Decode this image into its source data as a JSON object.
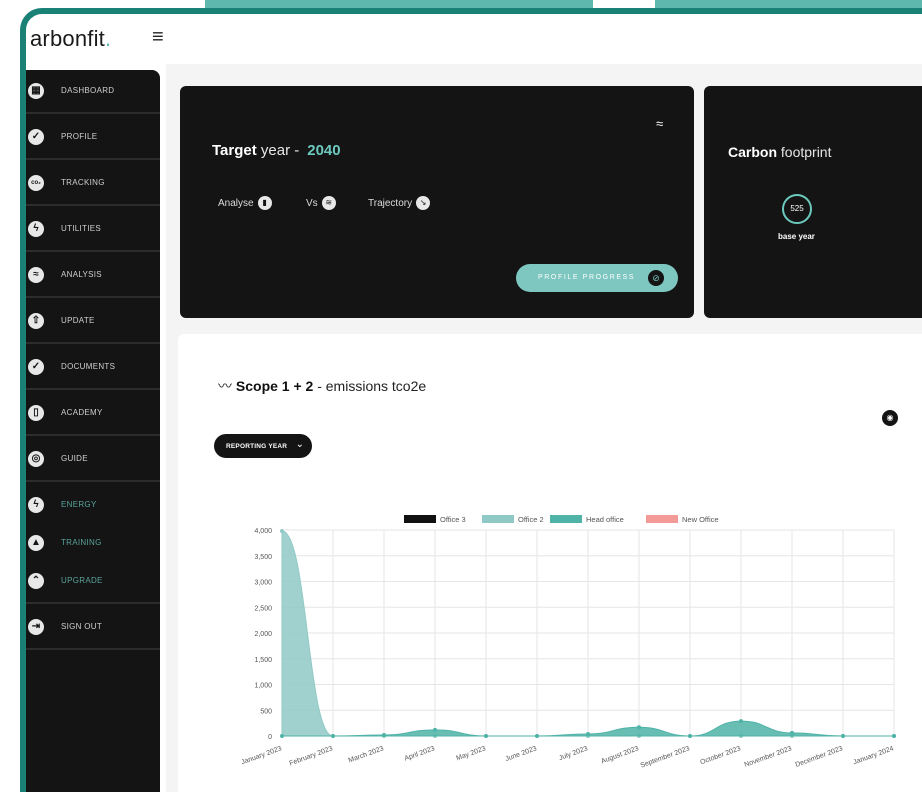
{
  "brand": {
    "name": "arbonfit",
    "dot": "."
  },
  "sidebar": {
    "items": [
      {
        "label": "DASHBOARD",
        "icon": "grid-icon"
      },
      {
        "label": "PROFILE",
        "icon": "shield-check-icon"
      },
      {
        "label": "TRACKING",
        "icon": "co2-icon"
      },
      {
        "label": "UTILITIES",
        "icon": "bolt-icon"
      },
      {
        "label": "ANALYSIS",
        "icon": "trend-icon"
      },
      {
        "label": "UPDATE",
        "icon": "upload-icon"
      },
      {
        "label": "DOCUMENTS",
        "icon": "badge-check-icon"
      },
      {
        "label": "ACADEMY",
        "icon": "book-icon"
      },
      {
        "label": "GUIDE",
        "icon": "compass-icon"
      },
      {
        "label": "ENERGY",
        "icon": "bolt-icon"
      },
      {
        "label": "TRAINING",
        "icon": "graduation-icon"
      },
      {
        "label": "UPGRADE",
        "icon": "arrow-up-icon"
      },
      {
        "label": "SIGN OUT",
        "icon": "sign-out-icon"
      }
    ]
  },
  "target": {
    "label_bold": "Target",
    "label_rest": "year -",
    "year": "2040",
    "analyse": "Analyse",
    "vs": "Vs",
    "trajectory": "Trajectory",
    "button": "PROFILE PROGRESS"
  },
  "carbon": {
    "label_bold": "Carbon",
    "label_rest": "footprint",
    "value": "525",
    "caption": "base year"
  },
  "scope": {
    "title_bold": "Scope 1 + 2",
    "title_rest": "- emissions tco2e",
    "dropdown": "REPORTING YEAR"
  },
  "chart_data": {
    "type": "area",
    "legend": [
      {
        "name": "Office 3",
        "color": "#111111"
      },
      {
        "name": "Office 2",
        "color": "#8fc9c6"
      },
      {
        "name": "Head office",
        "color": "#4fb3a7"
      },
      {
        "name": "New Office",
        "color": "#f39a96"
      }
    ],
    "legend_position": "top",
    "x": [
      "January 2023",
      "February 2023",
      "March 2023",
      "April 2023",
      "May 2023",
      "June 2023",
      "July 2023",
      "August 2023",
      "September 2023",
      "October 2023",
      "November 2023",
      "December 2023",
      "January 2024"
    ],
    "yticks": [
      "0",
      "500",
      "1,000",
      "1,500",
      "2,000",
      "2,500",
      "3,000",
      "3,500",
      "4,000"
    ],
    "ylim": [
      0,
      4000
    ],
    "grid": true,
    "series": [
      {
        "name": "Office 2",
        "color": "#8fc9c6",
        "values": [
          3980,
          0,
          0,
          0,
          0,
          0,
          0,
          0,
          0,
          0,
          0,
          0,
          0
        ]
      },
      {
        "name": "Head office",
        "color": "#4fb3a7",
        "values": [
          0,
          0,
          20,
          120,
          0,
          0,
          40,
          170,
          0,
          290,
          60,
          0,
          0
        ]
      }
    ]
  }
}
